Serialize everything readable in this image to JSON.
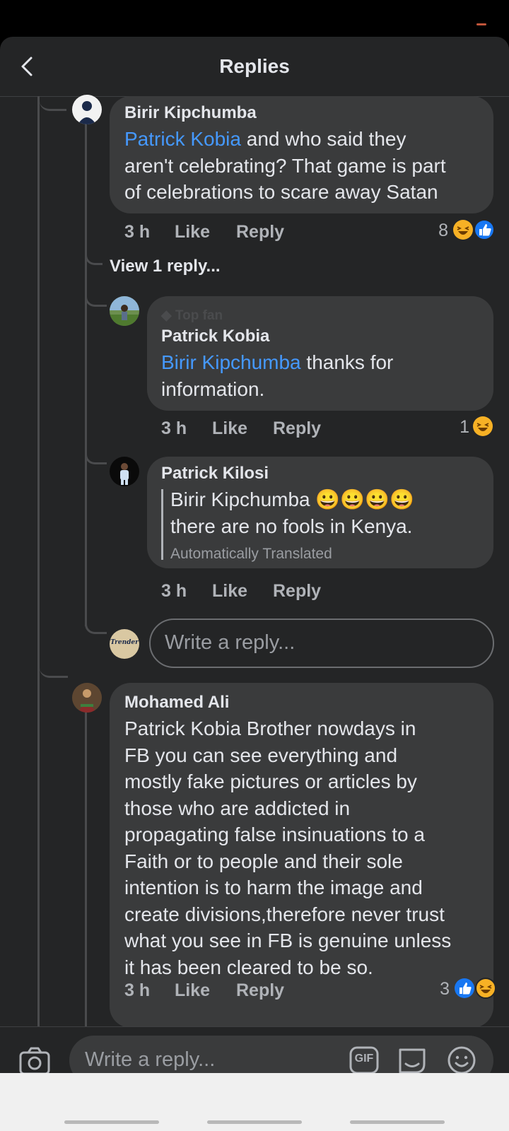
{
  "header": {
    "title": "Replies"
  },
  "comments": [
    {
      "author": "Birir Kipchumba",
      "mention": "Patrick Kobia",
      "line1": " and who said they",
      "line2": "aren't celebrating? That game is part",
      "line3": "of celebrations to scare away Satan",
      "time": "3 h",
      "like": "Like",
      "reply": "Reply",
      "reaction_count": "8",
      "reactions": [
        "haha-icon",
        "like-icon"
      ]
    },
    {
      "view_more": "View 1 reply..."
    },
    {
      "badge": "Top fan",
      "author": "Patrick Kobia",
      "mention": "Birir Kipchumba",
      "line1": " thanks for",
      "line2": "information.",
      "time": "3 h",
      "like": "Like",
      "reply": "Reply",
      "reaction_count": "1",
      "reactions": [
        "haha-icon"
      ]
    },
    {
      "author": "Patrick Kilosi",
      "line1": "Birir Kipchumba 😀😀😀😀",
      "line2": "there are no fools in Kenya.",
      "translated": "Automatically Translated",
      "time": "3 h",
      "like": "Like",
      "reply": "Reply"
    },
    {
      "author": "Mohamed Ali",
      "lines": [
        "Patrick Kobia Brother nowdays   in",
        "FB you can see everything and",
        "mostly fake pictures or articles by",
        "those who are addicted in",
        "propagating false insinuations to a",
        "Faith or to people and their sole",
        "intention is to harm the image and",
        "create divisions,therefore never trust",
        "what you see in FB is genuine unless",
        "it has been cleared to be so."
      ],
      "time": "3 h",
      "like": "Like",
      "reply": "Reply",
      "reaction_count": "3",
      "reactions": [
        "like-icon",
        "haha-icon"
      ]
    }
  ],
  "inline_reply": {
    "avatar_text": "Trender",
    "placeholder": "Write a reply..."
  },
  "composer": {
    "placeholder": "Write a reply...",
    "gif_label": "GIF"
  },
  "colors": {
    "background": "#242526",
    "bubble": "#3a3b3c",
    "mention": "#4599ff",
    "like_blue": "#1877f2",
    "haha_yellow": "#f7b125"
  }
}
